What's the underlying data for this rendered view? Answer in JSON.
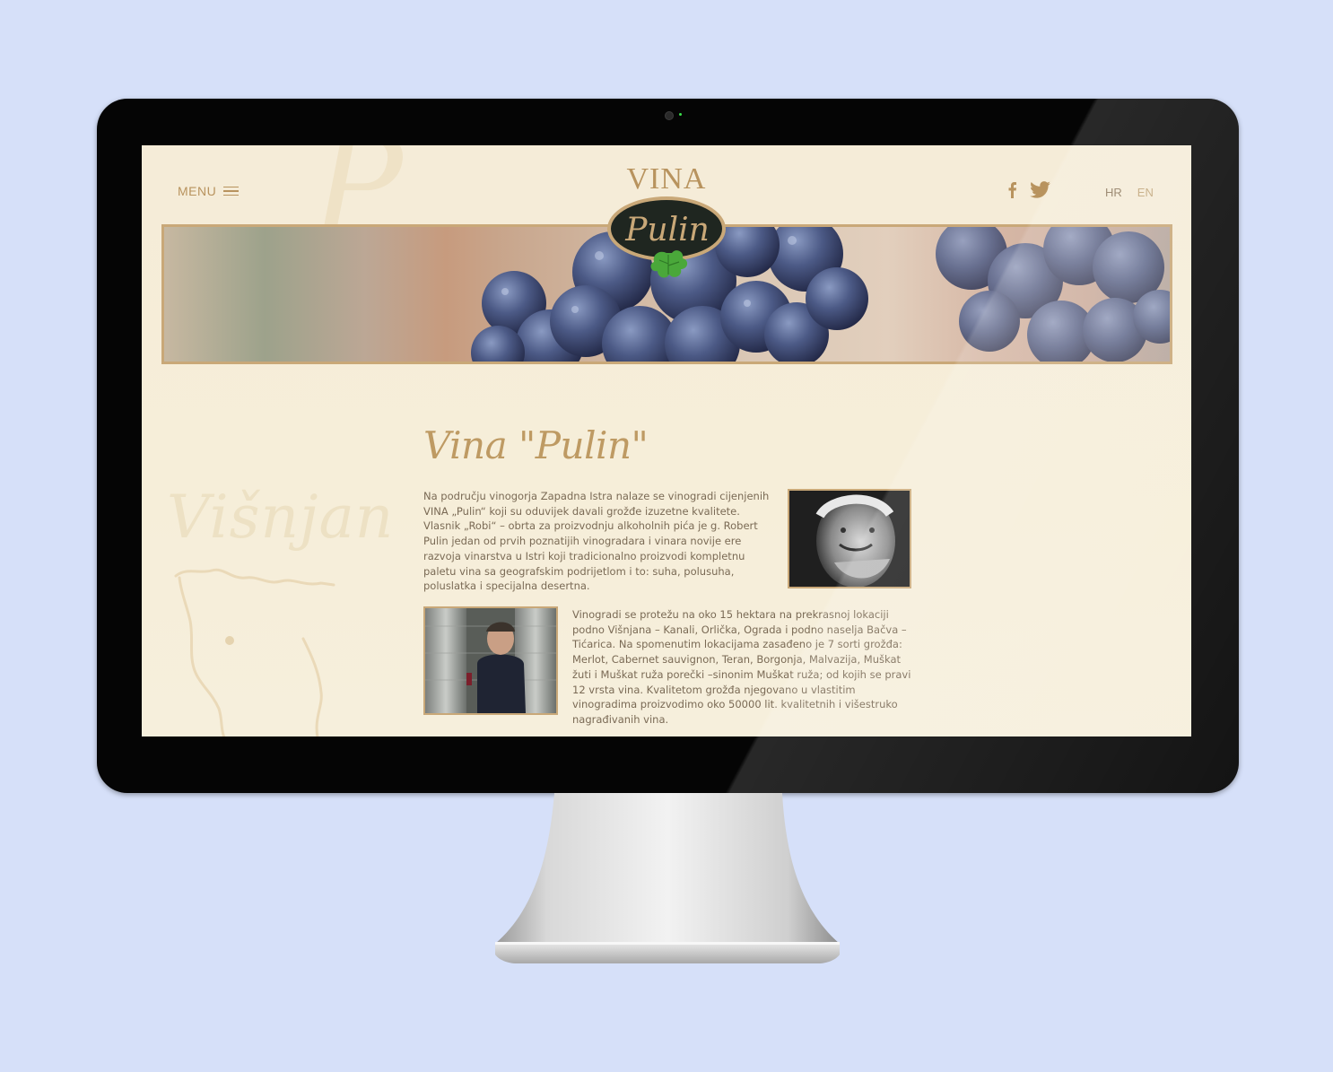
{
  "site": {
    "logo_top": "VINA",
    "logo_name": "Pulin"
  },
  "header": {
    "menu_label": "MENU",
    "social": [
      "facebook-icon",
      "twitter-icon"
    ],
    "languages": [
      {
        "code": "HR",
        "active": true
      },
      {
        "code": "EN",
        "active": false
      }
    ]
  },
  "decor": {
    "town_name": "Višnjan"
  },
  "main": {
    "title": "Vina \"Pulin\"",
    "paragraph_1": "Na području vinogorja Zapadna Istra nalaze se vinogradi cijenjenih VINA „Pulin“ koji su oduvijek davali grožđe izuzetne kvalitete. Vlasnik „Robi“ – obrta za proizvodnju alkoholnih pića je g. Robert Pulin jedan od prvih poznatijih vinogradara i vinara novije ere razvoja vinarstva u Istri koji tradicionalno proizvodi kompletnu paletu vina sa geografskim podrijetlom i to: suha, polusuha, poluslatka i specijalna desertna.",
    "paragraph_2": "Vinogradi se protežu na oko 15 hektara na prekrasnoj lokaciji podno Višnjana – Kanali, Orlička, Ograda i podno naselja Bačva – Tićarica. Na spomenutim lokacijama zasađeno je 7 sorti grožđa: Merlot, Cabernet sauvignon, Teran, Borgonja, Malvazija, Muškat žuti i Muškat ruža porečki –sinonim Muškat ruža; od kojih se pravi 12 vrsta vina. Kvalitetom grožđa njegovano u vlastitim vinogradima proizvodimo oko 50000 lit. kvalitetnih i višestruko nagrađivanih vina."
  },
  "colors": {
    "page_bg": "#d6e0f9",
    "screen_bg": "#f5ecd8",
    "accent_gold": "#be9a63",
    "frame_gold": "#c9a878",
    "logo_dark": "#1f2620",
    "leaf_green": "#4aa83a"
  }
}
